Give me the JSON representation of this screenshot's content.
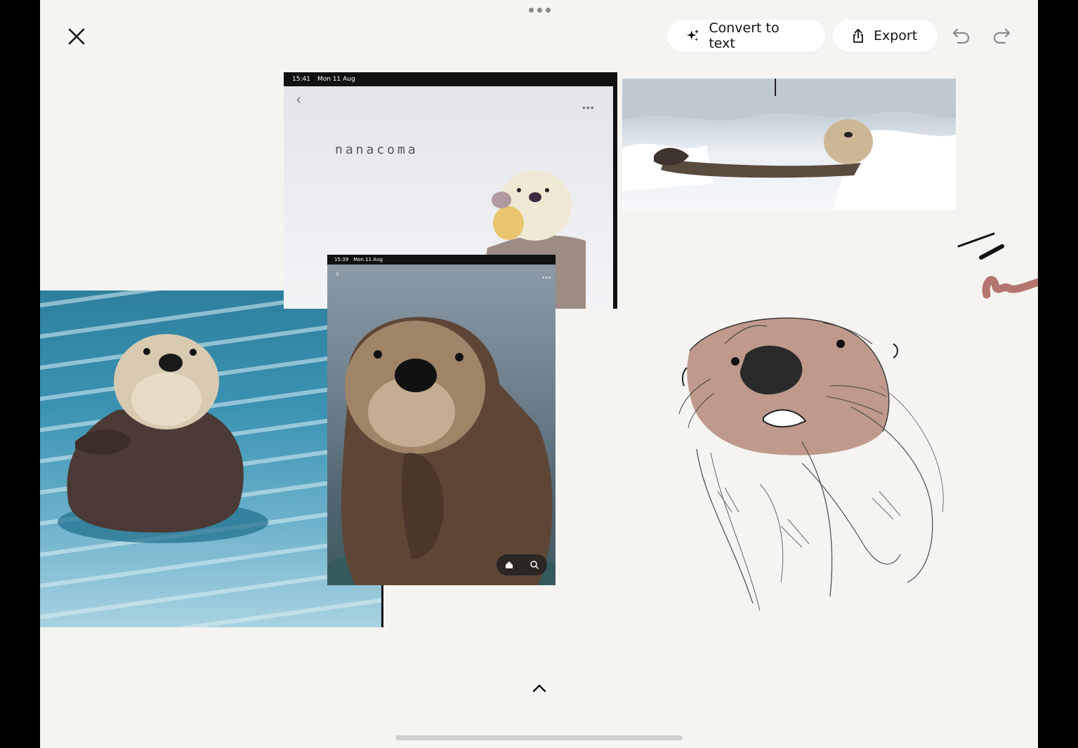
{
  "toolbar": {
    "convert_label": "Convert to text",
    "export_label": "Export",
    "close_icon": "close-icon",
    "sparkle_icon": "sparkle-icon",
    "share_icon": "share-icon",
    "undo_icon": "undo-icon",
    "redo_icon": "redo-icon",
    "drag_handle_icon": "more-dots-icon"
  },
  "screenshot_plush": {
    "time": "15:41",
    "date": "Mon 11 Aug",
    "brand_text": "nanacoma"
  },
  "screenshot_otter": {
    "time": "15:39",
    "date": "Mon 11 Aug"
  },
  "bottom": {
    "expand_icon": "chevron-up-icon"
  },
  "colors": {
    "canvas": "#f5f4f1",
    "sketch_fill": "#b58a7a",
    "scribble_pink": "#b3756d"
  }
}
